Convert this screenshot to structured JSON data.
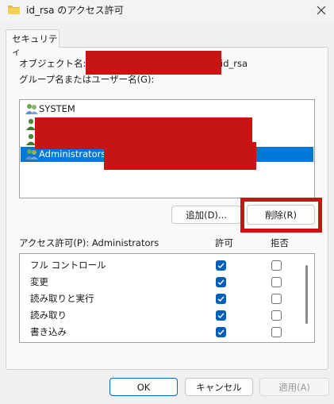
{
  "window": {
    "title": "id_rsa のアクセス許可",
    "icon": "folder-icon",
    "close_icon": "close-icon"
  },
  "tabs": [
    {
      "label": "セキュリティ",
      "active": true
    }
  ],
  "object": {
    "label": "オブジェクト名:",
    "path_suffix": "id_rsa"
  },
  "group_label": "グループ名またはユーザー名(G):",
  "users": [
    {
      "name": "SYSTEM",
      "icon": "group-users-icon",
      "selected": false
    },
    {
      "name": "",
      "icon": "user-icon",
      "selected": false
    },
    {
      "name": "",
      "icon": "user-icon",
      "selected": false
    },
    {
      "name": "Administrators (",
      "icon": "group-users-icon",
      "selected": true
    }
  ],
  "buttons": {
    "add": "追加(D)...",
    "remove": "削除(R)",
    "ok": "OK",
    "cancel": "キャンセル",
    "apply": "適用(A)"
  },
  "permissions": {
    "header": "アクセス許可(P): Administrators",
    "allow_header": "許可",
    "deny_header": "拒否",
    "rows": [
      {
        "name": "フル コントロール",
        "allow": true,
        "deny": false
      },
      {
        "name": "変更",
        "allow": true,
        "deny": false
      },
      {
        "name": "読み取りと実行",
        "allow": true,
        "deny": false
      },
      {
        "name": "読み取り",
        "allow": true,
        "deny": false
      },
      {
        "name": "書き込み",
        "allow": true,
        "deny": false
      }
    ]
  },
  "colors": {
    "accent": "#005fb8",
    "selection": "#0078d7",
    "redaction": "#c51616"
  }
}
